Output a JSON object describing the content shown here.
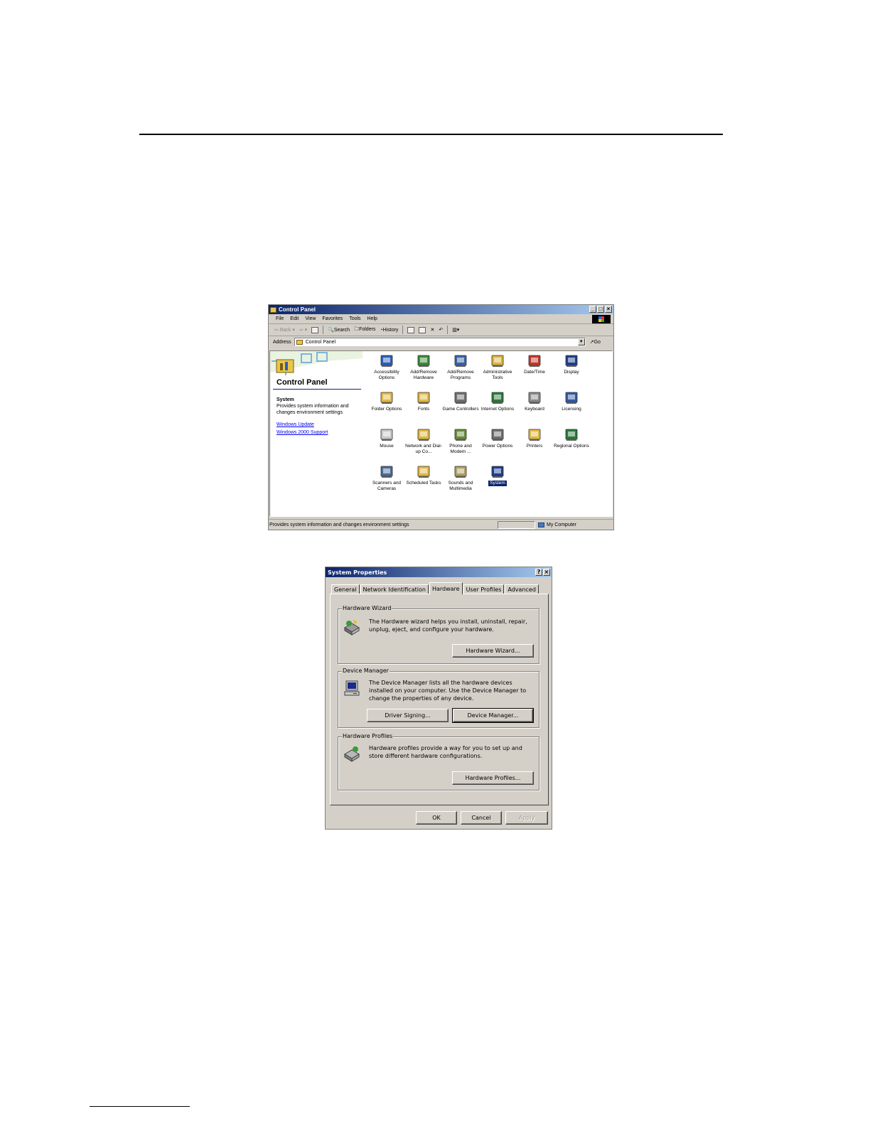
{
  "control_panel": {
    "window_title": "Control Panel",
    "menu": [
      "File",
      "Edit",
      "View",
      "Favorites",
      "Tools",
      "Help"
    ],
    "toolbar": {
      "back": "Back",
      "search": "Search",
      "folders": "Folders",
      "history": "History"
    },
    "address_label": "Address",
    "address_value": "Control Panel",
    "go_label": "Go",
    "panel_title": "Control Panel",
    "selected_name": "System",
    "selected_description": "Provides system information and changes environment settings",
    "links": [
      "Windows Update",
      "Windows 2000 Support"
    ],
    "items": [
      {
        "label": "Accessibility Options",
        "icon": "accessibility-icon",
        "color": "#2b5fb8"
      },
      {
        "label": "Add/Remove Hardware",
        "icon": "add-hardware-icon",
        "color": "#3c8a3c"
      },
      {
        "label": "Add/Remove Programs",
        "icon": "add-programs-icon",
        "color": "#3a63a8"
      },
      {
        "label": "Administrative Tools",
        "icon": "admin-tools-icon",
        "color": "#d9b43a"
      },
      {
        "label": "Date/Time",
        "icon": "date-time-icon",
        "color": "#c0392b"
      },
      {
        "label": "Display",
        "icon": "display-icon",
        "color": "#1e3f8f"
      },
      {
        "label": "Folder Options",
        "icon": "folder-options-icon",
        "color": "#e0b844"
      },
      {
        "label": "Fonts",
        "icon": "fonts-icon",
        "color": "#e0b844"
      },
      {
        "label": "Game Controllers",
        "icon": "game-controllers-icon",
        "color": "#707070"
      },
      {
        "label": "Internet Options",
        "icon": "internet-options-icon",
        "color": "#2c7a3a"
      },
      {
        "label": "Keyboard",
        "icon": "keyboard-icon",
        "color": "#8a8a8a"
      },
      {
        "label": "Licensing",
        "icon": "licensing-icon",
        "color": "#2f5aa8"
      },
      {
        "label": "Mouse",
        "icon": "mouse-icon",
        "color": "#c8c8c8"
      },
      {
        "label": "Network and Dial-up Co...",
        "icon": "network-icon",
        "color": "#e0b844"
      },
      {
        "label": "Phone and Modem ...",
        "icon": "phone-modem-icon",
        "color": "#6a8a3a"
      },
      {
        "label": "Power Options",
        "icon": "power-options-icon",
        "color": "#707070"
      },
      {
        "label": "Printers",
        "icon": "printers-icon",
        "color": "#e0b844"
      },
      {
        "label": "Regional Options",
        "icon": "regional-options-icon",
        "color": "#2a7a3a"
      },
      {
        "label": "Scanners and Cameras",
        "icon": "scanners-icon",
        "color": "#4a6a9a"
      },
      {
        "label": "Scheduled Tasks",
        "icon": "scheduled-tasks-icon",
        "color": "#e0b844"
      },
      {
        "label": "Sounds and Multimedia",
        "icon": "sounds-icon",
        "color": "#b0a060"
      },
      {
        "label": "System",
        "icon": "system-icon",
        "color": "#1e3f8f",
        "selected": true
      }
    ],
    "status_text": "Provides system information and changes environment settings",
    "status_zone": "My Computer"
  },
  "system_properties": {
    "title": "System Properties",
    "title_buttons": [
      "?",
      "×"
    ],
    "tabs": [
      "General",
      "Network Identification",
      "Hardware",
      "User Profiles",
      "Advanced"
    ],
    "active_tab": "Hardware",
    "groups": {
      "wizard": {
        "title": "Hardware Wizard",
        "text": "The Hardware wizard helps you install, uninstall, repair, unplug, eject, and configure your hardware.",
        "button": "Hardware Wizard..."
      },
      "device_manager": {
        "title": "Device Manager",
        "text": "The Device Manager lists all the hardware devices installed on your computer. Use the Device Manager to change the properties of any device.",
        "button_signing": "Driver Signing...",
        "button_manager": "Device Manager..."
      },
      "profiles": {
        "title": "Hardware Profiles",
        "text": "Hardware profiles provide a way for you to set up and store different hardware configurations.",
        "button": "Hardware Profiles..."
      }
    },
    "footer": {
      "ok": "OK",
      "cancel": "Cancel",
      "apply": "Apply"
    }
  }
}
